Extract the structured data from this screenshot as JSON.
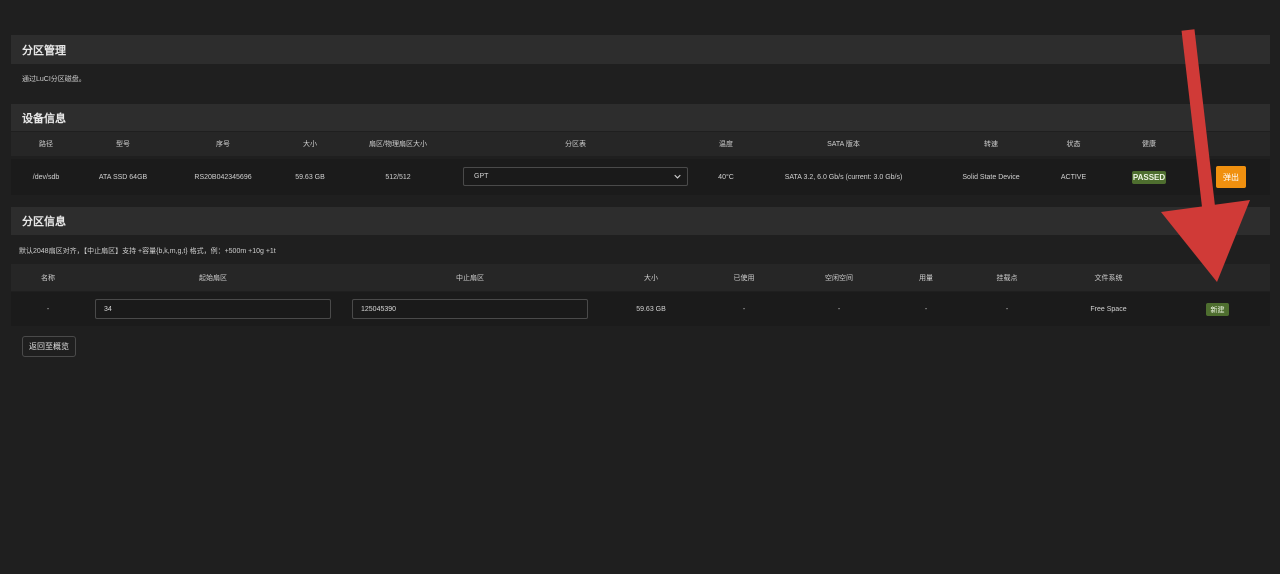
{
  "page": {
    "title": "分区管理",
    "description": "通过LuCI分区磁盘。",
    "back_button": "返回至概览"
  },
  "device_section": {
    "title": "设备信息",
    "headers": [
      "路径",
      "型号",
      "序号",
      "大小",
      "扇区/物理扇区大小",
      "分区表",
      "温度",
      "SATA 版本",
      "转速",
      "状态",
      "健康"
    ],
    "row": {
      "path": "/dev/sdb",
      "model": "ATA SSD 64GB",
      "serial": "RS20B042345696",
      "size": "59.63 GB",
      "sector": "512/512",
      "partition_table": "GPT",
      "temperature": "40°C",
      "sata": "SATA 3.2, 6.0 Gb/s (current: 3.0 Gb/s)",
      "rpm": "Solid State Device",
      "state": "ACTIVE",
      "health": "PASSED",
      "eject_label": "弹出"
    }
  },
  "partition_section": {
    "title": "分区信息",
    "note": "默认2048扇区对齐，【中止扇区】支持 +容量{b,k,m,g,t} 格式，例：+500m +10g +1t",
    "headers": [
      "名称",
      "起始扇区",
      "中止扇区",
      "大小",
      "已使用",
      "空闲空间",
      "用量",
      "挂载点",
      "文件系统"
    ],
    "row": {
      "name": "-",
      "start": "34",
      "end": "125045390",
      "size": "59.63 GB",
      "used": "-",
      "free": "-",
      "usage": "-",
      "mount": "-",
      "fs": "Free Space",
      "new_label": "新建"
    }
  },
  "colors": {
    "background": "#1f1f1f",
    "panel_header": "#2d2d2d",
    "passed_badge": "#4e6e2f",
    "eject_button": "#f0900f",
    "annotation_arrow": "#d03a37"
  }
}
